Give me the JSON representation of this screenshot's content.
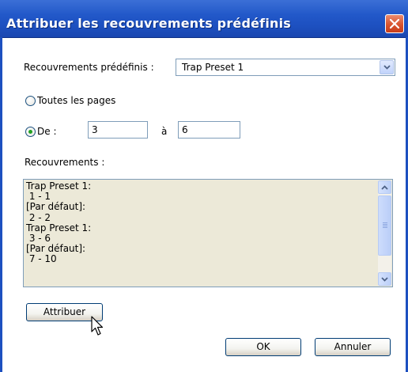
{
  "window": {
    "title": "Attribuer les recouvrements prédéfinis"
  },
  "preset": {
    "label": "Recouvrements prédéfinis :",
    "selected": "Trap Preset 1"
  },
  "range": {
    "all_pages_label": "Toutes les pages",
    "all_pages_selected": false,
    "from_label": "De :",
    "from_selected": true,
    "from_value": "3",
    "to_label": "à",
    "to_value": "6"
  },
  "traps": {
    "label": "Recouvrements :",
    "lines": [
      "Trap Preset 1:",
      " 1 - 1",
      "[Par défaut]:",
      " 2 - 2",
      "Trap Preset 1:",
      " 3 - 6",
      "[Par défaut]:",
      " 7 - 10"
    ]
  },
  "buttons": {
    "assign": "Attribuer",
    "ok": "OK",
    "cancel": "Annuler"
  },
  "colors": {
    "titlebar": "#1d50c0",
    "close": "#d9542e",
    "list_bg": "#ece9d8"
  },
  "icons": [
    "close-icon",
    "chevron-down-icon",
    "chevron-up-icon",
    "mouse-cursor-icon"
  ]
}
